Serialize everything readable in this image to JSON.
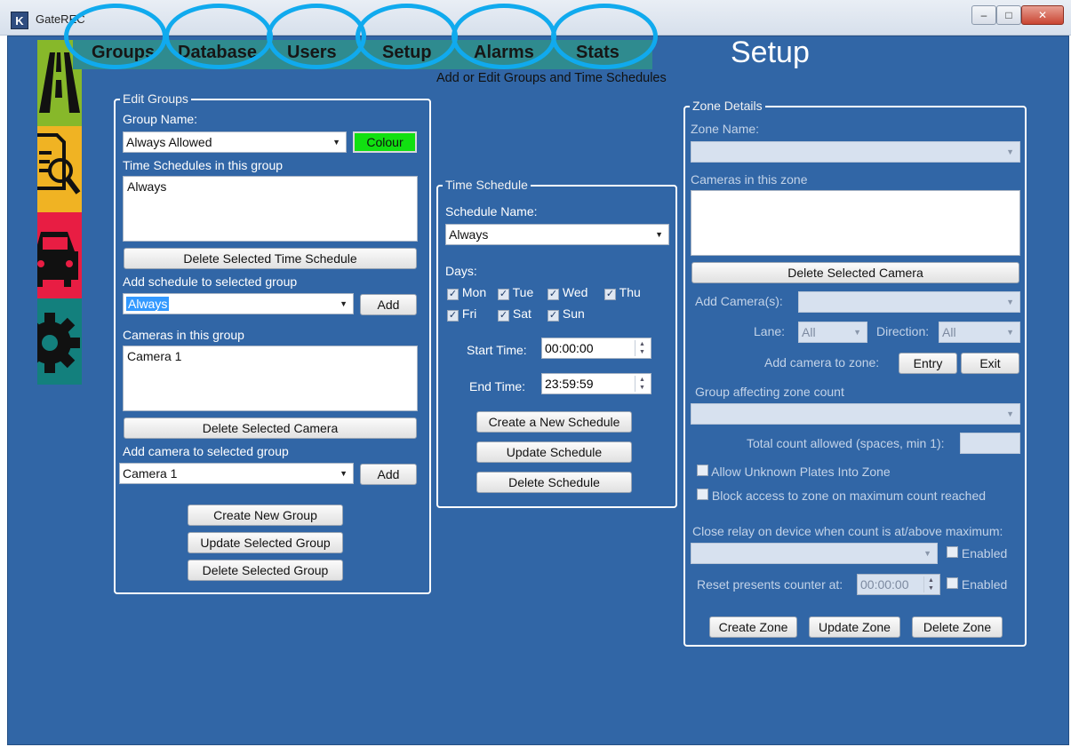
{
  "window": {
    "title": "GateREC",
    "app_icon_glyph": "K",
    "minimize": "–",
    "maximize": "□",
    "close": "✕"
  },
  "tabs": [
    {
      "label": "Groups"
    },
    {
      "label": "Database"
    },
    {
      "label": "Users"
    },
    {
      "label": "Setup"
    },
    {
      "label": "Alarms"
    },
    {
      "label": "Stats"
    }
  ],
  "sidebar_icons": [
    "road-icon",
    "document-search-icon",
    "car-icon",
    "gear-icon"
  ],
  "page": {
    "title": "Setup",
    "subtitle": "Add or Edit Groups and Time Schedules"
  },
  "edit_groups": {
    "legend": "Edit Groups",
    "group_name_label": "Group Name:",
    "group_name_value": "Always Allowed",
    "colour_button": "Colour",
    "time_schedules_label": "Time Schedules in this group",
    "time_schedules": [
      "Always"
    ],
    "delete_schedule_button": "Delete Selected Time Schedule",
    "add_schedule_label": "Add schedule to selected group",
    "add_schedule_value": "Always",
    "add_button": "Add",
    "cameras_label": "Cameras in this group",
    "cameras": [
      "Camera 1"
    ],
    "delete_camera_button": "Delete Selected Camera",
    "add_camera_label": "Add camera to selected group",
    "add_camera_value": "Camera 1",
    "create_group_button": "Create New Group",
    "update_group_button": "Update Selected Group",
    "delete_group_button": "Delete Selected Group"
  },
  "time_schedule": {
    "legend": "Time Schedule",
    "schedule_name_label": "Schedule Name:",
    "schedule_name_value": "Always",
    "days_label": "Days:",
    "days": [
      {
        "label": "Mon",
        "checked": true
      },
      {
        "label": "Tue",
        "checked": true
      },
      {
        "label": "Wed",
        "checked": true
      },
      {
        "label": "Thu",
        "checked": true
      },
      {
        "label": "Fri",
        "checked": true
      },
      {
        "label": "Sat",
        "checked": true
      },
      {
        "label": "Sun",
        "checked": true
      }
    ],
    "start_time_label": "Start Time:",
    "start_time_value": "00:00:00",
    "end_time_label": "End Time:",
    "end_time_value": "23:59:59",
    "create_button": "Create a New Schedule",
    "update_button": "Update Schedule",
    "delete_button": "Delete Schedule"
  },
  "zone_details": {
    "legend": "Zone Details",
    "zone_name_label": "Zone Name:",
    "zone_name_value": "",
    "cameras_label": "Cameras in this zone",
    "delete_camera_button": "Delete Selected Camera",
    "add_cameras_label": "Add Camera(s):",
    "lane_label": "Lane:",
    "lane_value": "All",
    "direction_label": "Direction:",
    "direction_value": "All",
    "add_camera_to_zone_label": "Add camera to zone:",
    "entry_button": "Entry",
    "exit_button": "Exit",
    "group_affecting_label": "Group affecting zone count",
    "group_affecting_value": "",
    "total_count_label": "Total count allowed (spaces, min 1):",
    "total_count_value": "",
    "allow_unknown_label": "Allow Unknown Plates Into Zone",
    "block_access_label": "Block access to zone on maximum count reached",
    "close_relay_label": "Close relay on device when count is at/above maximum:",
    "relay_device_value": "",
    "enabled_label": "Enabled",
    "reset_counter_label": "Reset presents counter at:",
    "reset_counter_value": "00:00:00",
    "create_zone_button": "Create Zone",
    "update_zone_button": "Update Zone",
    "delete_zone_button": "Delete Zone"
  },
  "colors": {
    "client_bg": "#3166a6",
    "tab_bar": "#2f8b8f",
    "highlight_ring": "#10aaee",
    "colour_button": "#11e011"
  }
}
